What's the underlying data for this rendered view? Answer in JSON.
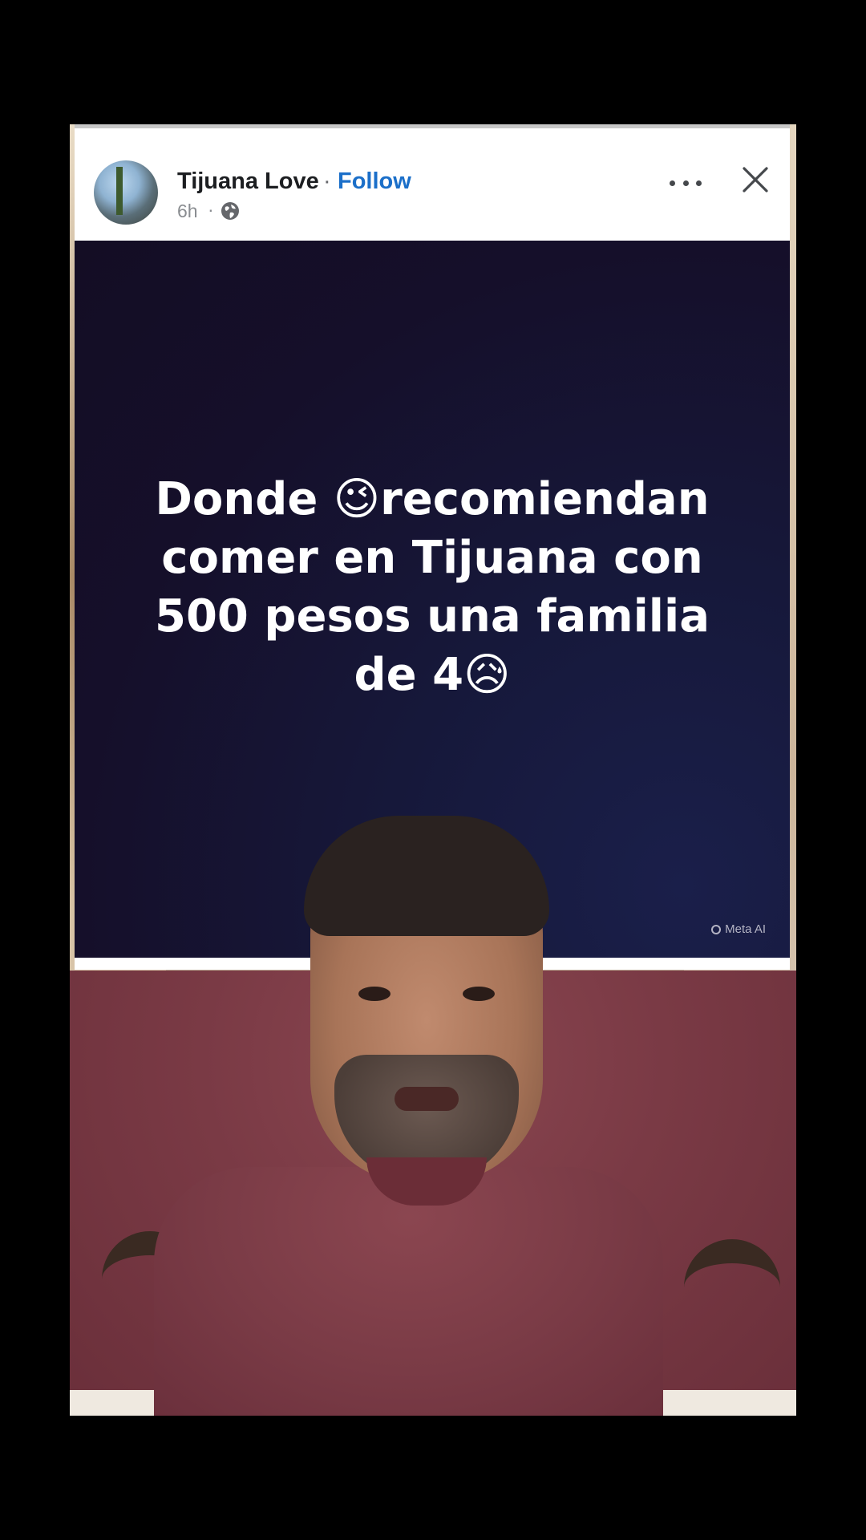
{
  "post": {
    "author": "Tijuana Love",
    "separator": "·",
    "follow_label": "Follow",
    "time": "6h",
    "time_separator": "·",
    "audience_icon": "globe-icon",
    "more_icon": "more-options-icon",
    "close_icon": "close-icon"
  },
  "media": {
    "text": "Donde 😉recomiendan comer en Tijuana con 500 pesos una familia de 4😥",
    "watermark": "Meta AI"
  }
}
